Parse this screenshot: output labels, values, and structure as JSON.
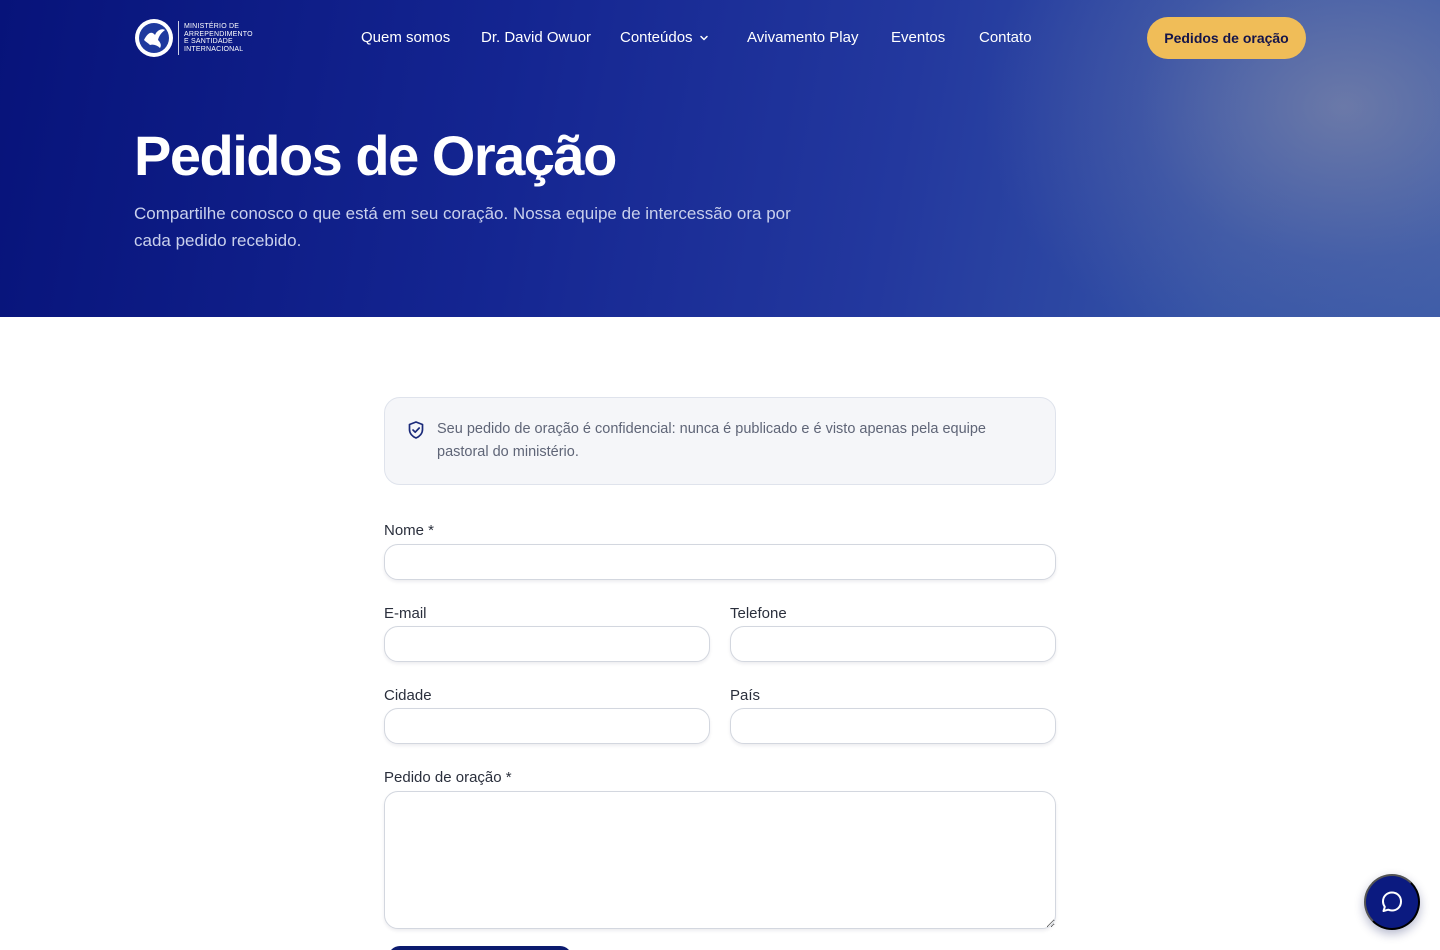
{
  "brand": {
    "logo_lines": [
      "MINISTÉRIO DE",
      "ARREPENDIMENTO",
      "E SANTIDADE",
      "INTERNACIONAL"
    ]
  },
  "nav": {
    "items": [
      "Quem somos",
      "Dr. David Owuor",
      "Conteúdos",
      "Avivamento Play",
      "Eventos",
      "Contato"
    ],
    "cta": "Pedidos de oração"
  },
  "hero": {
    "title": "Pedidos de Oração",
    "subtitle": "Compartilhe conosco o que está em seu coração. Nossa equipe de intercessão ora por cada pedido recebido."
  },
  "notice": {
    "icon": "shield-check-icon",
    "text": "Seu pedido de oração é confidencial: nunca é publicado e é visto apenas pela equipe pastoral do ministério."
  },
  "form": {
    "name_label": "Nome *",
    "name_value": "",
    "email_label": "E-mail",
    "email_value": "",
    "phone_label": "Telefone",
    "phone_value": "",
    "city_label": "Cidade",
    "city_value": "",
    "country_label": "País",
    "country_value": "",
    "request_label": "Pedido de oração *",
    "request_value": ""
  },
  "chat": {
    "icon": "chat-bubble-icon"
  },
  "colors": {
    "hero_start": "#07137a",
    "hero_end": "#3a5aa8",
    "cta_bg": "#f0bd58",
    "chat_bg": "#0b1a80"
  }
}
